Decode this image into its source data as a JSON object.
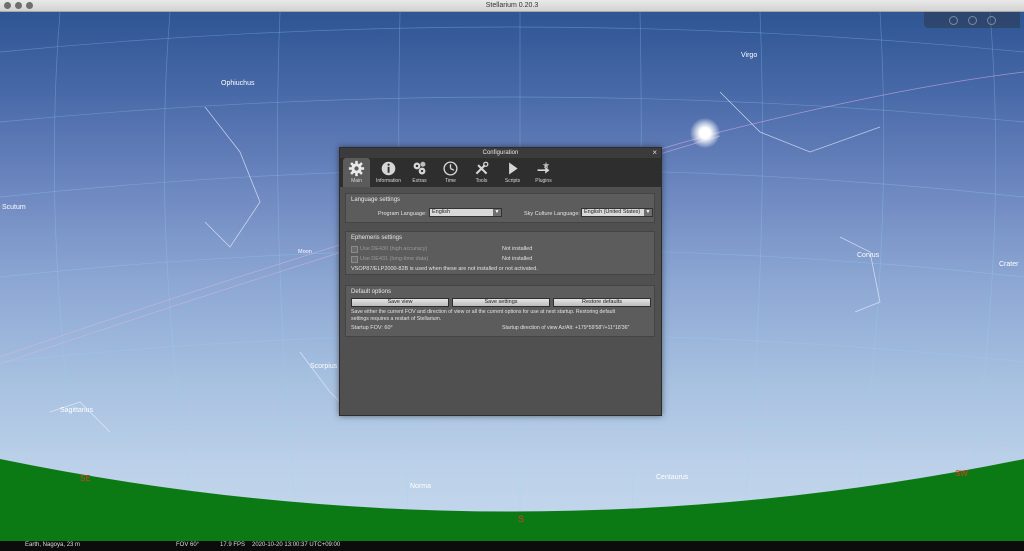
{
  "window": {
    "title": "Stellarium 0.20.3"
  },
  "sky": {
    "constellations": [
      "Ophiuchus",
      "Virgo",
      "Scutum",
      "Corvus",
      "Scorpius",
      "Sagittarius",
      "Norma",
      "Centaurus"
    ],
    "objects": [
      "Moon",
      "Crater"
    ],
    "cardinal_points": {
      "se": "SE",
      "s": "S",
      "sw": "SW"
    }
  },
  "colors": {
    "sky_top": "#2f5593",
    "sky_bottom": "#c5d8ee",
    "ground": "#0b7a15",
    "cardinal": "#e33a20"
  },
  "status_bar": {
    "location": "Earth, Nagoya, 23 m",
    "fov": "FOV 60°",
    "fps": "17.9 FPS",
    "datetime": "2020-10-20 13:00:37 UTC+09:00"
  },
  "dialog": {
    "title": "Configuration",
    "close_icon": "×",
    "tabs": [
      {
        "label": "Main",
        "icon": "gear-icon",
        "active": true
      },
      {
        "label": "Information",
        "icon": "info-icon",
        "active": false
      },
      {
        "label": "Extras",
        "icon": "extras-gears-icon",
        "active": false
      },
      {
        "label": "Time",
        "icon": "clock-icon",
        "active": false
      },
      {
        "label": "Tools",
        "icon": "tools-icon",
        "active": false
      },
      {
        "label": "Scripts",
        "icon": "play-icon",
        "active": false
      },
      {
        "label": "Plugins",
        "icon": "plugins-icon",
        "active": false
      }
    ],
    "language": {
      "title": "Language settings",
      "program_label": "Program Language:",
      "program_value": "English",
      "skyculture_label": "Sky Culture Language:",
      "skyculture_value": "English (United States)"
    },
    "ephemeris": {
      "title": "Ephemeris settings",
      "de430_label": "Use DE430 (high accuracy)",
      "de430_status": "Not installed",
      "de431_label": "Use DE431 (long-time data)",
      "de431_status": "Not installed",
      "note": "VSOP87/ELP2000-82B is used when these are not installed or not activated."
    },
    "defaults": {
      "title": "Default options",
      "save_view": "Save view",
      "save_settings": "Save settings",
      "restore_defaults": "Restore defaults",
      "desc_line1": "Save either the current FOV and direction of view or all the current options for use at next startup. Restoring default",
      "desc_line2": "settings requires a restart of Stellarium.",
      "startup_fov": "Startup FOV: 60°",
      "startup_direction": "Startup direction of view Az/Alt: +179°59'58\"/+11°18'36\""
    }
  }
}
